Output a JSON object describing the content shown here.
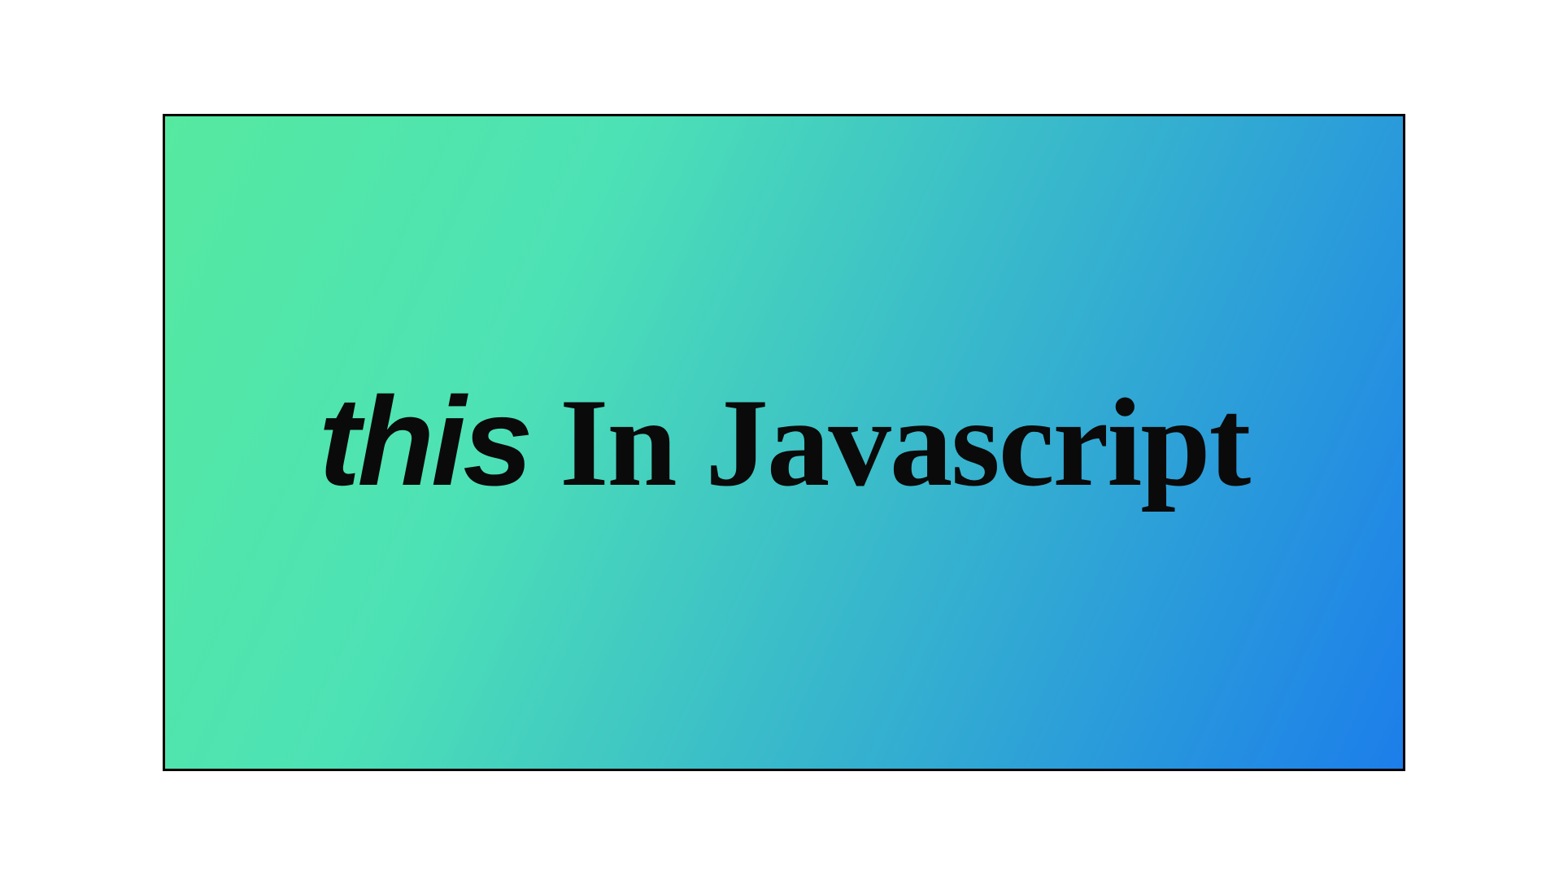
{
  "banner": {
    "keyword": "this",
    "rest": " In Javascript",
    "colors": {
      "gradient_start": "#55e9a0",
      "gradient_end": "#1c7eea",
      "text": "#0a0a0a",
      "border": "#000000"
    }
  }
}
